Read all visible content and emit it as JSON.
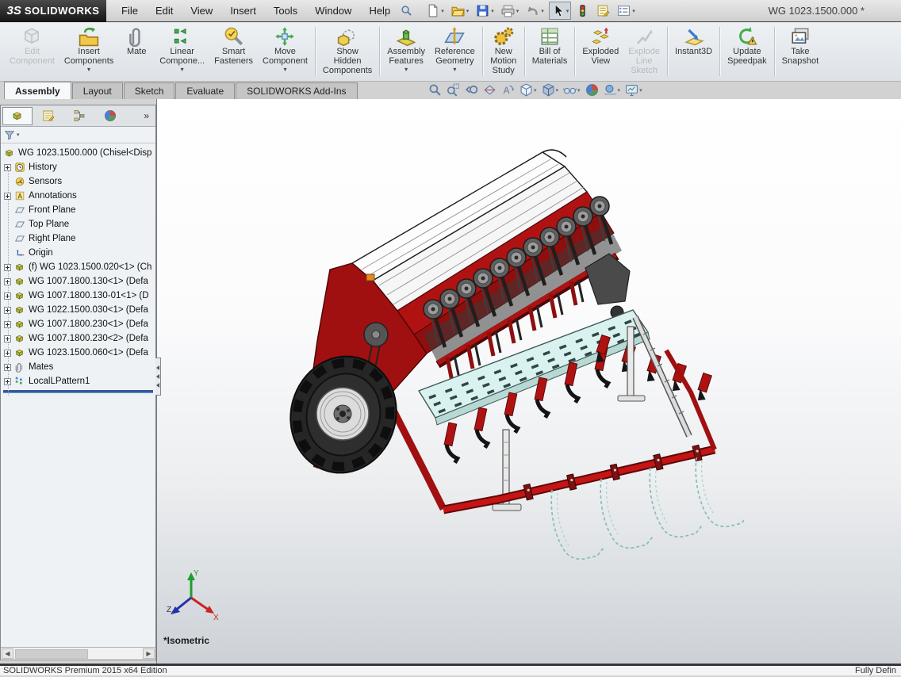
{
  "titlebar": {
    "brand_mark": "3S",
    "brand": "SOLIDWORKS",
    "menus": [
      "File",
      "Edit",
      "View",
      "Insert",
      "Tools",
      "Window",
      "Help"
    ],
    "quick_tools": [
      {
        "name": "new-document",
        "dropdown": true
      },
      {
        "name": "open-document",
        "dropdown": true
      },
      {
        "name": "save-document",
        "dropdown": true
      },
      {
        "name": "print-document",
        "dropdown": true
      },
      {
        "name": "undo",
        "dropdown": true
      },
      {
        "name": "select-tool",
        "dropdown": true,
        "pressed": true
      },
      {
        "name": "rebuild"
      },
      {
        "name": "file-properties"
      },
      {
        "name": "options",
        "dropdown": true
      }
    ],
    "document_title": "WG 1023.1500.000 *"
  },
  "command_manager": {
    "buttons": [
      {
        "lines": [
          "Edit",
          "Component"
        ],
        "icon": "edit-component",
        "disabled": true
      },
      {
        "lines": [
          "Insert",
          "Components"
        ],
        "icon": "insert-components",
        "dropdown": true
      },
      {
        "lines": [
          "Mate"
        ],
        "icon": "mate"
      },
      {
        "lines": [
          "Linear",
          "Compone..."
        ],
        "icon": "linear-component-pattern",
        "dropdown": true
      },
      {
        "lines": [
          "Smart",
          "Fasteners"
        ],
        "icon": "smart-fasteners"
      },
      {
        "lines": [
          "Move",
          "Component"
        ],
        "icon": "move-component",
        "dropdown": true
      },
      {
        "separator": true
      },
      {
        "lines": [
          "Show",
          "Hidden",
          "Components"
        ],
        "icon": "show-hidden-components"
      },
      {
        "separator": true
      },
      {
        "lines": [
          "Assembly",
          "Features"
        ],
        "icon": "assembly-features",
        "dropdown": true
      },
      {
        "lines": [
          "Reference",
          "Geometry"
        ],
        "icon": "reference-geometry",
        "dropdown": true
      },
      {
        "separator": true
      },
      {
        "lines": [
          "New",
          "Motion",
          "Study"
        ],
        "icon": "new-motion-study"
      },
      {
        "separator": true
      },
      {
        "lines": [
          "Bill of",
          "Materials"
        ],
        "icon": "bill-of-materials"
      },
      {
        "separator": true
      },
      {
        "lines": [
          "Exploded",
          "View"
        ],
        "icon": "exploded-view"
      },
      {
        "lines": [
          "Explode",
          "Line",
          "Sketch"
        ],
        "icon": "explode-line-sketch",
        "disabled": true
      },
      {
        "separator": true
      },
      {
        "lines": [
          "Instant3D"
        ],
        "icon": "instant3d"
      },
      {
        "separator": true
      },
      {
        "lines": [
          "Update",
          "Speedpak"
        ],
        "icon": "update-speedpak"
      },
      {
        "separator": true
      },
      {
        "lines": [
          "Take",
          "Snapshot"
        ],
        "icon": "take-snapshot"
      }
    ]
  },
  "ribbon_tabs": [
    {
      "label": "Assembly",
      "active": true
    },
    {
      "label": "Layout"
    },
    {
      "label": "Sketch"
    },
    {
      "label": "Evaluate"
    },
    {
      "label": "SOLIDWORKS Add-Ins"
    }
  ],
  "hud_toolbar": [
    {
      "name": "zoom-to-fit"
    },
    {
      "name": "zoom-to-area"
    },
    {
      "name": "previous-view"
    },
    {
      "name": "section-view"
    },
    {
      "name": "dynamic-annotation-views"
    },
    {
      "name": "view-orientation",
      "dropdown": true
    },
    {
      "name": "display-style",
      "dropdown": true
    },
    {
      "name": "hide-show-items",
      "dropdown": true
    },
    {
      "name": "edit-appearance"
    },
    {
      "name": "apply-scene",
      "dropdown": true
    },
    {
      "name": "view-settings",
      "dropdown": true
    }
  ],
  "feature_panel": {
    "tabs": [
      {
        "name": "featuremanager-design-tree",
        "active": true
      },
      {
        "name": "propertymanager"
      },
      {
        "name": "configurationmanager"
      },
      {
        "name": "displaymanager"
      }
    ],
    "expand_chevron": "»",
    "tree": [
      {
        "label": "WG 1023.1500.000  (Chisel<Disp",
        "icon": "assembly",
        "root": true
      },
      {
        "label": "History",
        "icon": "history",
        "expandable": true
      },
      {
        "label": "Sensors",
        "icon": "sensors"
      },
      {
        "label": "Annotations",
        "icon": "annotations",
        "expandable": true
      },
      {
        "label": "Front Plane",
        "icon": "plane"
      },
      {
        "label": "Top Plane",
        "icon": "plane"
      },
      {
        "label": "Right Plane",
        "icon": "plane"
      },
      {
        "label": "Origin",
        "icon": "origin"
      },
      {
        "label": "(f) WG 1023.1500.020<1>  (Ch",
        "icon": "component",
        "expandable": true
      },
      {
        "label": "WG 1007.1800.130<1>  (Defa",
        "icon": "component",
        "expandable": true
      },
      {
        "label": "WG 1007.1800.130-01<1>  (D",
        "icon": "component",
        "expandable": true
      },
      {
        "label": "WG 1022.1500.030<1>  (Defa",
        "icon": "component",
        "expandable": true
      },
      {
        "label": "WG 1007.1800.230<1>  (Defa",
        "icon": "component",
        "expandable": true
      },
      {
        "label": "WG 1007.1800.230<2>  (Defa",
        "icon": "component",
        "expandable": true
      },
      {
        "label": "WG 1023.1500.060<1>  (Defa",
        "icon": "component",
        "expandable": true
      },
      {
        "label": "Mates",
        "icon": "mates",
        "expandable": true
      },
      {
        "label": "LocalLPattern1",
        "icon": "pattern",
        "expandable": true
      }
    ]
  },
  "viewport": {
    "view_label": "*Isometric",
    "axis_labels": {
      "x": "X",
      "y": "Y",
      "z": "Z"
    }
  },
  "statusbar": {
    "left": "SOLIDWORKS Premium 2015 x64 Edition",
    "right": "Fully Defin"
  }
}
